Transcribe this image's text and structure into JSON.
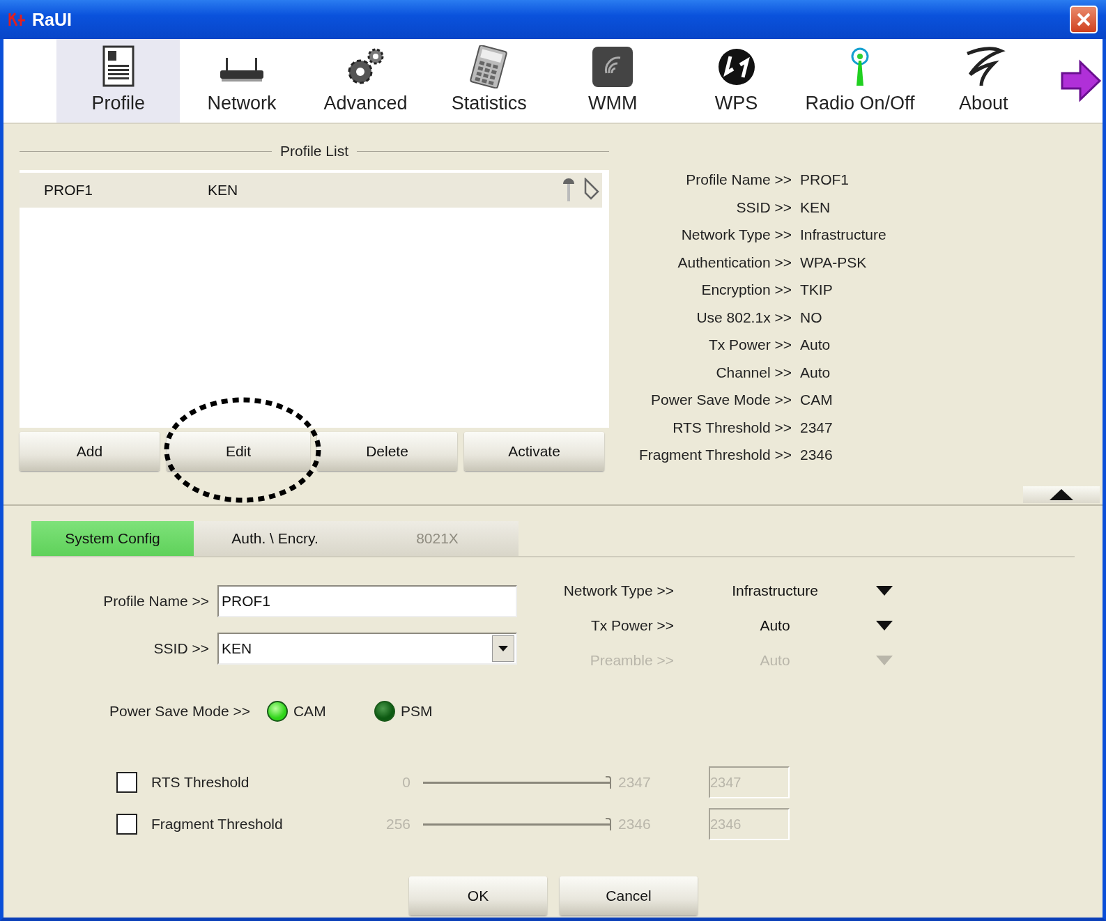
{
  "window": {
    "title": "RaUI"
  },
  "toolbar": [
    {
      "label": "Profile",
      "selected": true
    },
    {
      "label": "Network",
      "selected": false
    },
    {
      "label": "Advanced",
      "selected": false
    },
    {
      "label": "Statistics",
      "selected": false
    },
    {
      "label": "WMM",
      "selected": false
    },
    {
      "label": "WPS",
      "selected": false
    },
    {
      "label": "Radio On/Off",
      "selected": false
    },
    {
      "label": "About",
      "selected": false
    }
  ],
  "profile_list": {
    "title": "Profile List",
    "rows": [
      {
        "name": "PROF1",
        "ssid": "KEN",
        "selected": true
      }
    ],
    "buttons": [
      "Add",
      "Edit",
      "Delete",
      "Activate"
    ]
  },
  "details": [
    {
      "label": "Profile Name >>",
      "value": "PROF1"
    },
    {
      "label": "SSID >>",
      "value": "KEN"
    },
    {
      "label": "Network Type >>",
      "value": "Infrastructure"
    },
    {
      "label": "Authentication >>",
      "value": "WPA-PSK"
    },
    {
      "label": "Encryption >>",
      "value": "TKIP"
    },
    {
      "label": "Use 802.1x >>",
      "value": "NO"
    },
    {
      "label": "Tx Power >>",
      "value": "Auto"
    },
    {
      "label": "Channel >>",
      "value": "Auto"
    },
    {
      "label": "Power Save Mode >>",
      "value": "CAM"
    },
    {
      "label": "RTS Threshold >>",
      "value": "2347"
    },
    {
      "label": "Fragment Threshold >>",
      "value": "2346"
    }
  ],
  "tabs": [
    {
      "label": "System Config",
      "selected": true,
      "disabled": false
    },
    {
      "label": "Auth. \\ Encry.",
      "selected": false,
      "disabled": false
    },
    {
      "label": "8021X",
      "selected": false,
      "disabled": true
    }
  ],
  "form": {
    "profile_name": {
      "label": "Profile Name >>",
      "value": "PROF1"
    },
    "ssid": {
      "label": "SSID >>",
      "value": "KEN"
    },
    "power_save": {
      "label": "Power Save Mode >>",
      "options": [
        {
          "label": "CAM",
          "selected": true
        },
        {
          "label": "PSM",
          "selected": false
        }
      ]
    },
    "selects": [
      {
        "label": "Network Type >>",
        "value": "Infrastructure",
        "disabled": false
      },
      {
        "label": "Tx Power >>",
        "value": "Auto",
        "disabled": false
      },
      {
        "label": "Preamble >>",
        "value": "Auto",
        "disabled": true
      }
    ],
    "thresholds": [
      {
        "label": "RTS Threshold",
        "checked": false,
        "min": "0",
        "max": "2347",
        "level": 1,
        "value": "2347"
      },
      {
        "label": "Fragment Threshold",
        "checked": false,
        "min": "256",
        "max": "2346",
        "level": 1,
        "value": "2346"
      }
    ]
  },
  "buttons": [
    "OK",
    "Cancel"
  ]
}
